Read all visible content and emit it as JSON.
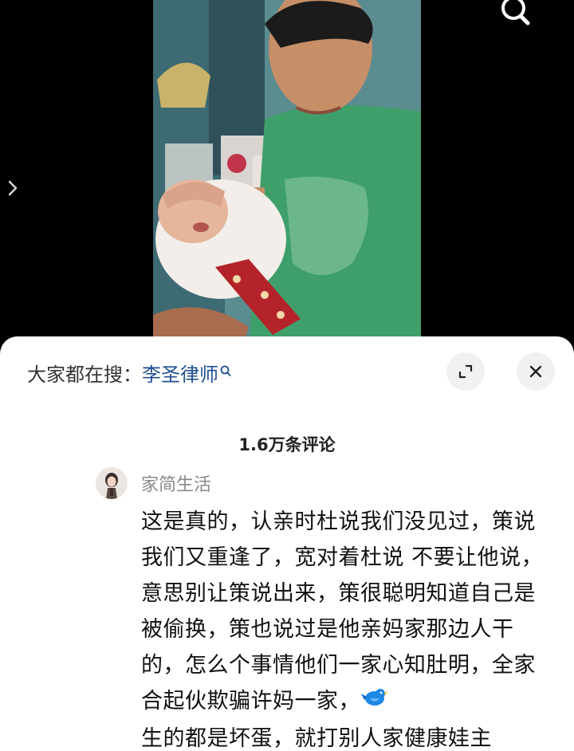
{
  "viewer": {
    "search_icon": "search-icon",
    "nav_icon": "chevron-right-icon"
  },
  "sheet": {
    "search_hint_label": "大家都在搜：",
    "search_term": "李圣律师",
    "expand_icon": "expand-icon",
    "close_icon": "close-icon",
    "comment_count": "1.6万条评论"
  },
  "comment": {
    "username": "家简生活",
    "text_before_emoji": "这是真的，认亲时杜说我们没见过，策说我们又重逢了，宽对着杜说 不要让他说，意思别让策说出来，策很聪明知道自己是被偷换，策也说过是他亲妈家那边人干的，怎么个事情他们一家心知肚明，全家合起伙欺骗许妈一家，",
    "emoji": "bird-emoji",
    "text_after_emoji": "生的都是坏蛋，就打别人家健康娃主"
  }
}
